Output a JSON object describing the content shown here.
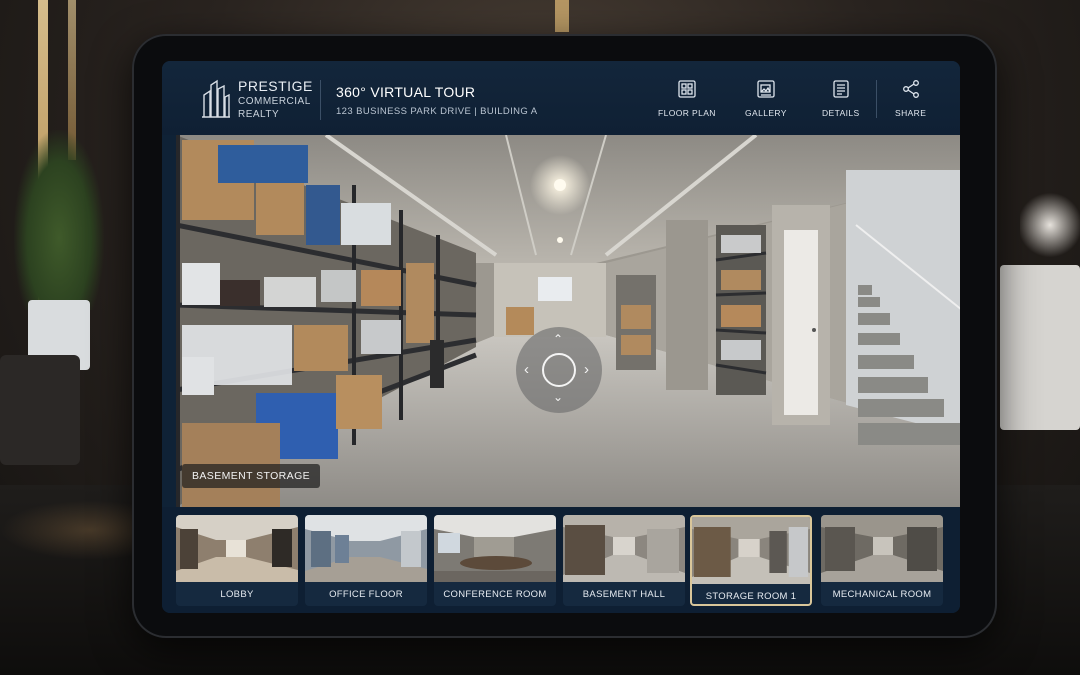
{
  "brand": {
    "line1": "PRESTIGE",
    "line2": "COMMERCIAL",
    "line3": "REALTY"
  },
  "tour": {
    "title": "360° VIRTUAL TOUR",
    "address": "123 BUSINESS PARK DRIVE | BUILDING A"
  },
  "nav": [
    {
      "label": "FLOOR PLAN",
      "icon": "floor-plan-icon"
    },
    {
      "label": "GALLERY",
      "icon": "gallery-icon"
    },
    {
      "label": "DETAILS",
      "icon": "details-icon"
    },
    {
      "label": "SHARE",
      "icon": "share-icon"
    }
  ],
  "scene": {
    "label": "BASEMENT STORAGE"
  },
  "thumbnails": [
    {
      "label": "LOBBY",
      "active": false
    },
    {
      "label": "OFFICE FLOOR",
      "active": false
    },
    {
      "label": "CONFERENCE ROOM",
      "active": false
    },
    {
      "label": "BASEMENT HALL",
      "active": false
    },
    {
      "label": "STORAGE ROOM 1",
      "active": true
    },
    {
      "label": "MECHANICAL ROOM",
      "active": false
    }
  ],
  "colors": {
    "screen_bg": "#0f2236",
    "active_border": "#d9c69a",
    "text": "#e6ebf1"
  }
}
